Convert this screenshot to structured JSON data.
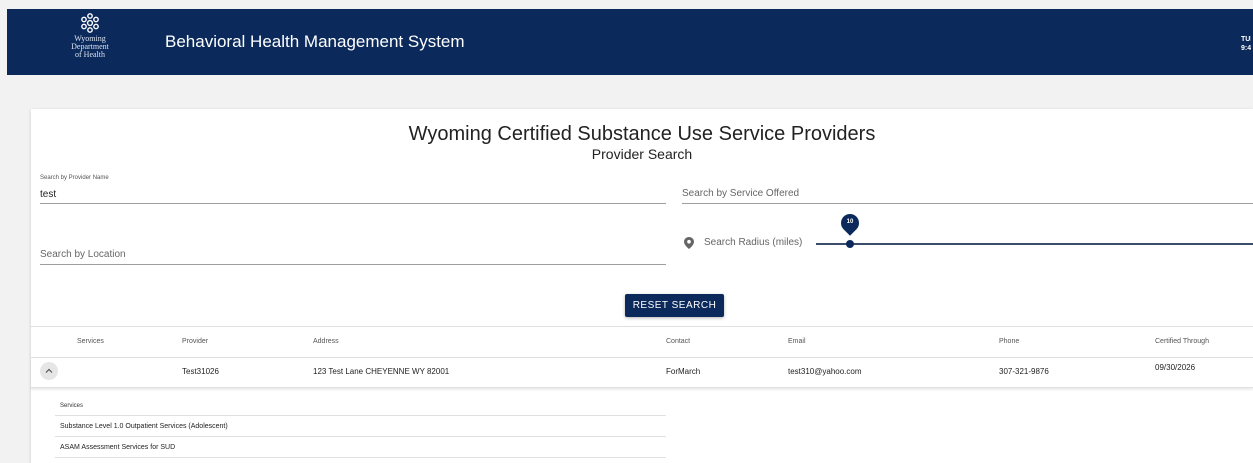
{
  "header": {
    "logo_lines": [
      "Wyoming",
      "Department",
      "of Health"
    ],
    "app_title": "Behavioral Health Management System",
    "clock_date": "TUE",
    "clock_time": "9:4"
  },
  "card": {
    "title": "Wyoming Certified Substance Use Service Providers",
    "subtitle": "Provider Search"
  },
  "search": {
    "provider_name_label": "Search by Provider Name",
    "provider_name_value": "test",
    "service_placeholder": "Search by Service Offered",
    "location_placeholder": "Search by Location",
    "radius_label": "Search Radius (miles)",
    "radius_value": "10",
    "reset_label": "RESET SEARCH"
  },
  "table": {
    "columns": [
      "Services",
      "Provider",
      "Address",
      "Contact",
      "Email",
      "Phone",
      "Certified Through"
    ],
    "rows": [
      {
        "provider": "Test31026",
        "address": "123 Test Lane CHEYENNE WY 82001",
        "contact": "ForMarch",
        "email": "test310@yahoo.com",
        "phone": "307-321-9876",
        "certified_through": "09/30/2026"
      }
    ]
  },
  "services_detail": {
    "header": "Services",
    "items": [
      "Substance Level 1.0 Outpatient Services (Adolescent)",
      "ASAM Assessment Services for SUD"
    ]
  },
  "colors": {
    "brand_navy": "#0b2a5b",
    "page_background": "#f2f2f2"
  },
  "icons": [
    "wyoming-seal-icon",
    "location-pin-icon",
    "chevron-up-icon"
  ]
}
